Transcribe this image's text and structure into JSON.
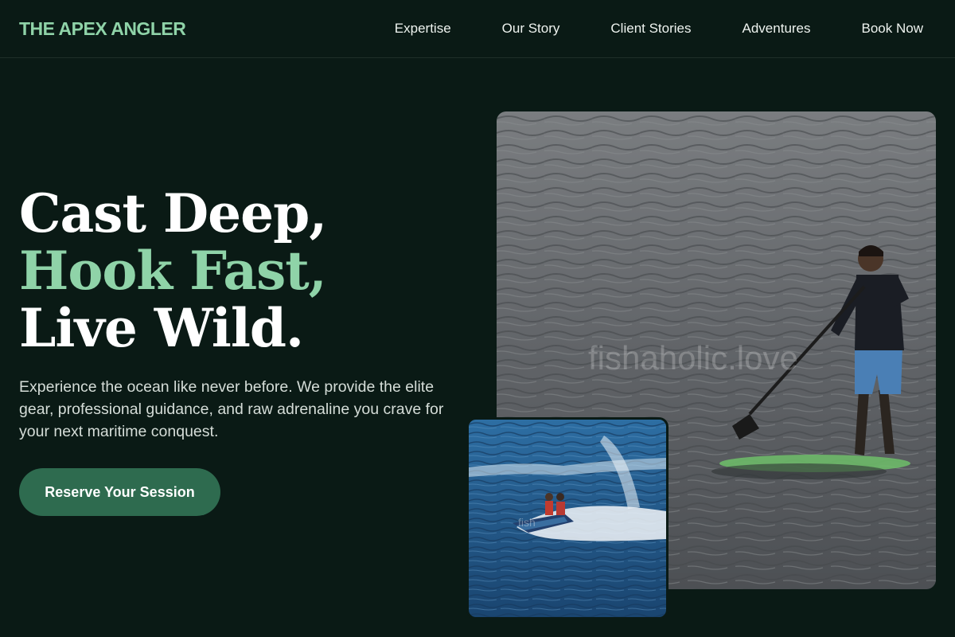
{
  "brand": {
    "name": "THE APEX ANGLER"
  },
  "nav": {
    "items": [
      {
        "label": "Expertise"
      },
      {
        "label": "Our Story"
      },
      {
        "label": "Client Stories"
      },
      {
        "label": "Adventures"
      },
      {
        "label": "Book Now"
      }
    ]
  },
  "hero": {
    "title_line1": "Cast Deep,",
    "title_line2": "Hook Fast,",
    "title_line3": "Live Wild.",
    "description": "Experience the ocean like never before. We provide the elite gear, professional guidance, and raw adrenaline you crave for your next maritime conquest.",
    "cta_label": "Reserve Your Session"
  },
  "images": {
    "main_watermark": "fishaholic.love",
    "small_watermark": "fish"
  },
  "colors": {
    "background": "#0a1a15",
    "accent_green": "#8fd3a8",
    "button": "#2e6b4f"
  }
}
